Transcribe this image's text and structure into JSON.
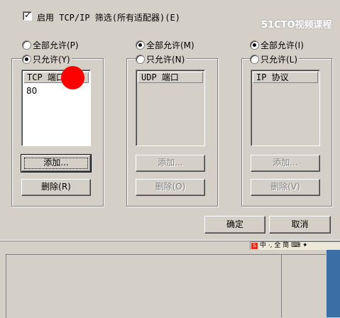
{
  "header": {
    "enable_filter_label": "启用 TCP/IP 筛选(所有适配器)(E)",
    "enable_filter_checked": true
  },
  "watermark": {
    "text": "51CTO视频课程"
  },
  "tcp": {
    "permit_all_label": "全部允许(P)",
    "permit_only_label": "只允许(Y)",
    "selected": "permit_only",
    "list_header": "TCP 端口",
    "ports": [
      "80"
    ],
    "add_label": "添加...",
    "remove_label": "删除(R)"
  },
  "udp": {
    "permit_all_label": "全部允许(M)",
    "permit_only_label": "只允许(N)",
    "selected": "permit_all",
    "list_header": "UDP 端口",
    "add_label": "添加...",
    "remove_label": "删除(O)"
  },
  "ip": {
    "permit_all_label": "全部允许(I)",
    "permit_only_label": "只允许(L)",
    "selected": "permit_all",
    "list_header": "IP 协议",
    "add_label": "添加...",
    "remove_label": "删除(V)"
  },
  "footer": {
    "ok_label": "确定",
    "cancel_label": "取消"
  },
  "ime_bar": {
    "text": "中 ·, 全 简"
  },
  "colors": {
    "dialog_bg": "#d4d0c8",
    "cursor_marker": "#ff0000",
    "desktop_blue": "#3a6ea5"
  }
}
